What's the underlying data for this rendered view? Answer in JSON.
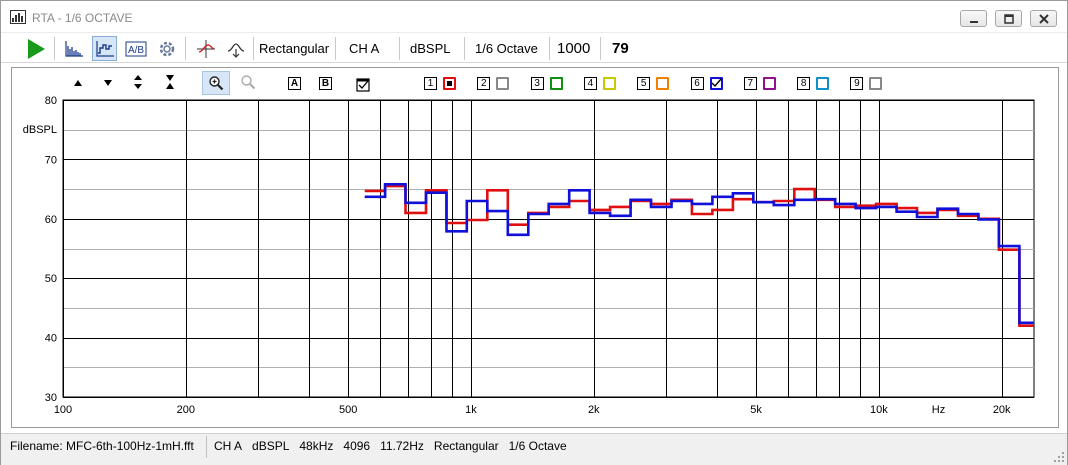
{
  "window": {
    "title": "RTA - 1/6 OCTAVE",
    "min_icon": "minimize-icon",
    "max_icon": "maximize-icon",
    "close_icon": "close-icon"
  },
  "toolbar": {
    "play_icon": "play-icon",
    "window_label": "Rectangular",
    "channel_label": "CH A",
    "units_label": "dBSPL",
    "resolution_label": "1/6 Octave",
    "averages_value": "1000",
    "count_value": "79"
  },
  "chart_controls": {
    "buttons": [
      {
        "name": "scale-up-icon",
        "glyph": "▲"
      },
      {
        "name": "scale-down-icon",
        "glyph": "▼"
      },
      {
        "name": "expand-icon",
        "glyph": "⬍"
      },
      {
        "name": "compress-icon",
        "glyph": "⧗"
      }
    ],
    "zoom_in_icon": "zoom-in-icon",
    "zoom_out_icon": "zoom-out-icon",
    "trace_a": "A",
    "trace_b": "B",
    "overlays": [
      {
        "num": "1",
        "color": "#e01010",
        "checked": false,
        "filled": true
      },
      {
        "num": "2",
        "color": "#888888",
        "checked": false,
        "filled": false
      },
      {
        "num": "3",
        "color": "#109010",
        "checked": false,
        "filled": false
      },
      {
        "num": "4",
        "color": "#c8c800",
        "checked": false,
        "filled": false
      },
      {
        "num": "5",
        "color": "#f08000",
        "checked": false,
        "filled": false
      },
      {
        "num": "6",
        "color": "#1010d8",
        "checked": true,
        "filled": false
      },
      {
        "num": "7",
        "color": "#901090",
        "checked": false,
        "filled": false
      },
      {
        "num": "8",
        "color": "#1090c8",
        "checked": false,
        "filled": false
      },
      {
        "num": "9",
        "color": "#888888",
        "checked": false,
        "filled": false
      }
    ]
  },
  "chart_data": {
    "type": "line",
    "title": "",
    "xlabel": "Hz",
    "ylabel": "dBSPL",
    "xscale": "log",
    "xlim": [
      100,
      24000
    ],
    "ylim": [
      30,
      80
    ],
    "grid": true,
    "x_ticks": [
      {
        "value": 100,
        "label": "100"
      },
      {
        "value": 200,
        "label": "200"
      },
      {
        "value": 500,
        "label": "500"
      },
      {
        "value": 1000,
        "label": "1k"
      },
      {
        "value": 2000,
        "label": "2k"
      },
      {
        "value": 5000,
        "label": "5k"
      },
      {
        "value": 10000,
        "label": "10k"
      },
      {
        "value": 20000,
        "label": "20k"
      }
    ],
    "y_ticks": [
      {
        "value": 80,
        "label": "80"
      },
      {
        "value": 70,
        "label": "70"
      },
      {
        "value": 60,
        "label": "60"
      },
      {
        "value": 50,
        "label": "50"
      },
      {
        "value": 40,
        "label": "40"
      },
      {
        "value": 30,
        "label": "30"
      }
    ],
    "series": [
      {
        "color": "#e01010",
        "edges": [
          549,
          616,
          691,
          776,
          871,
          977,
          1097,
          1231,
          1382,
          1551,
          1741,
          1954,
          2193,
          2462,
          2763,
          3101,
          3481,
          3907,
          4386,
          4922,
          5525,
          6202,
          6961,
          7813,
          8770,
          9844,
          11049,
          12402,
          13920,
          15625,
          17538,
          19686,
          22097,
          23900
        ],
        "values": [
          64.7,
          65.5,
          61.0,
          64.8,
          59.3,
          59.8,
          64.8,
          59.0,
          61.0,
          62.0,
          63.0,
          61.5,
          62.0,
          63.0,
          62.5,
          63.2,
          60.8,
          61.5,
          63.3,
          62.8,
          63.0,
          65.0,
          63.2,
          62.0,
          62.2,
          62.5,
          61.8,
          61.0,
          61.5,
          60.5,
          60.0,
          54.8,
          42.0
        ]
      },
      {
        "color": "#1010d8",
        "edges": [
          549,
          616,
          691,
          776,
          871,
          977,
          1097,
          1231,
          1382,
          1551,
          1741,
          1954,
          2193,
          2462,
          2763,
          3101,
          3481,
          3907,
          4386,
          4922,
          5525,
          6202,
          6961,
          7813,
          8770,
          9844,
          11049,
          12402,
          13920,
          15625,
          17538,
          19686,
          22097,
          23900
        ],
        "values": [
          63.7,
          65.8,
          62.7,
          64.4,
          57.9,
          63.0,
          61.3,
          57.3,
          60.8,
          62.5,
          64.8,
          61.0,
          60.5,
          63.2,
          62.0,
          63.0,
          62.5,
          63.7,
          64.3,
          62.8,
          62.3,
          63.2,
          63.3,
          62.5,
          61.8,
          62.0,
          61.2,
          60.3,
          61.7,
          60.8,
          59.9,
          55.4,
          42.5
        ]
      }
    ]
  },
  "status": {
    "filename": "Filename: MFC-6th-100Hz-1mH.fft",
    "channel": "CH A",
    "units": "dBSPL",
    "sample_rate": "48kHz",
    "fft_size": "4096",
    "bin_width": "11.72Hz",
    "window": "Rectangular",
    "resolution": "1/6 Octave"
  }
}
